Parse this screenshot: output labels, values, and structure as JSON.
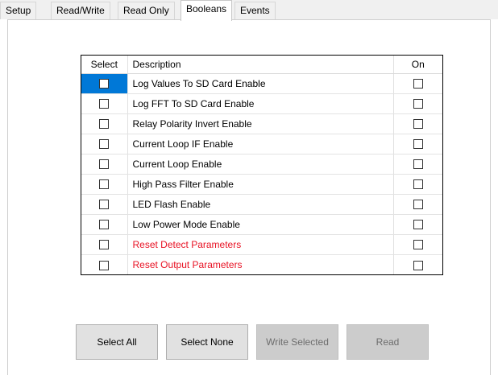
{
  "tabs": [
    {
      "label": "Setup"
    },
    {
      "label": "Read/Write"
    },
    {
      "label": "Read Only"
    },
    {
      "label": "Booleans"
    },
    {
      "label": "Events"
    }
  ],
  "active_tab": "Booleans",
  "grid": {
    "columns": {
      "select": "Select",
      "description": "Description",
      "on": "On"
    },
    "rows": [
      {
        "description": "Log Values To SD Card Enable",
        "select": false,
        "on": false,
        "color": "#000000"
      },
      {
        "description": "Log FFT To SD Card Enable",
        "select": false,
        "on": false,
        "color": "#000000"
      },
      {
        "description": "Relay Polarity Invert Enable",
        "select": false,
        "on": false,
        "color": "#000000"
      },
      {
        "description": "Current Loop IF Enable",
        "select": false,
        "on": false,
        "color": "#000000"
      },
      {
        "description": "Current Loop Enable",
        "select": false,
        "on": false,
        "color": "#000000"
      },
      {
        "description": "High Pass Filter Enable",
        "select": false,
        "on": false,
        "color": "#000000"
      },
      {
        "description": "LED Flash Enable",
        "select": false,
        "on": false,
        "color": "#000000"
      },
      {
        "description": "Low Power Mode Enable",
        "select": false,
        "on": false,
        "color": "#000000"
      },
      {
        "description": "Reset Detect Parameters",
        "select": false,
        "on": false,
        "color": "#e81123"
      },
      {
        "description": "Reset Output Parameters",
        "select": false,
        "on": false,
        "color": "#e81123"
      }
    ],
    "current_cell_color": "#0078d7"
  },
  "buttons": {
    "select_all": "Select All",
    "select_none": "Select None",
    "write_selected": "Write Selected",
    "read": "Read"
  },
  "icons": {
    "checkbox": "checkbox-icon"
  }
}
